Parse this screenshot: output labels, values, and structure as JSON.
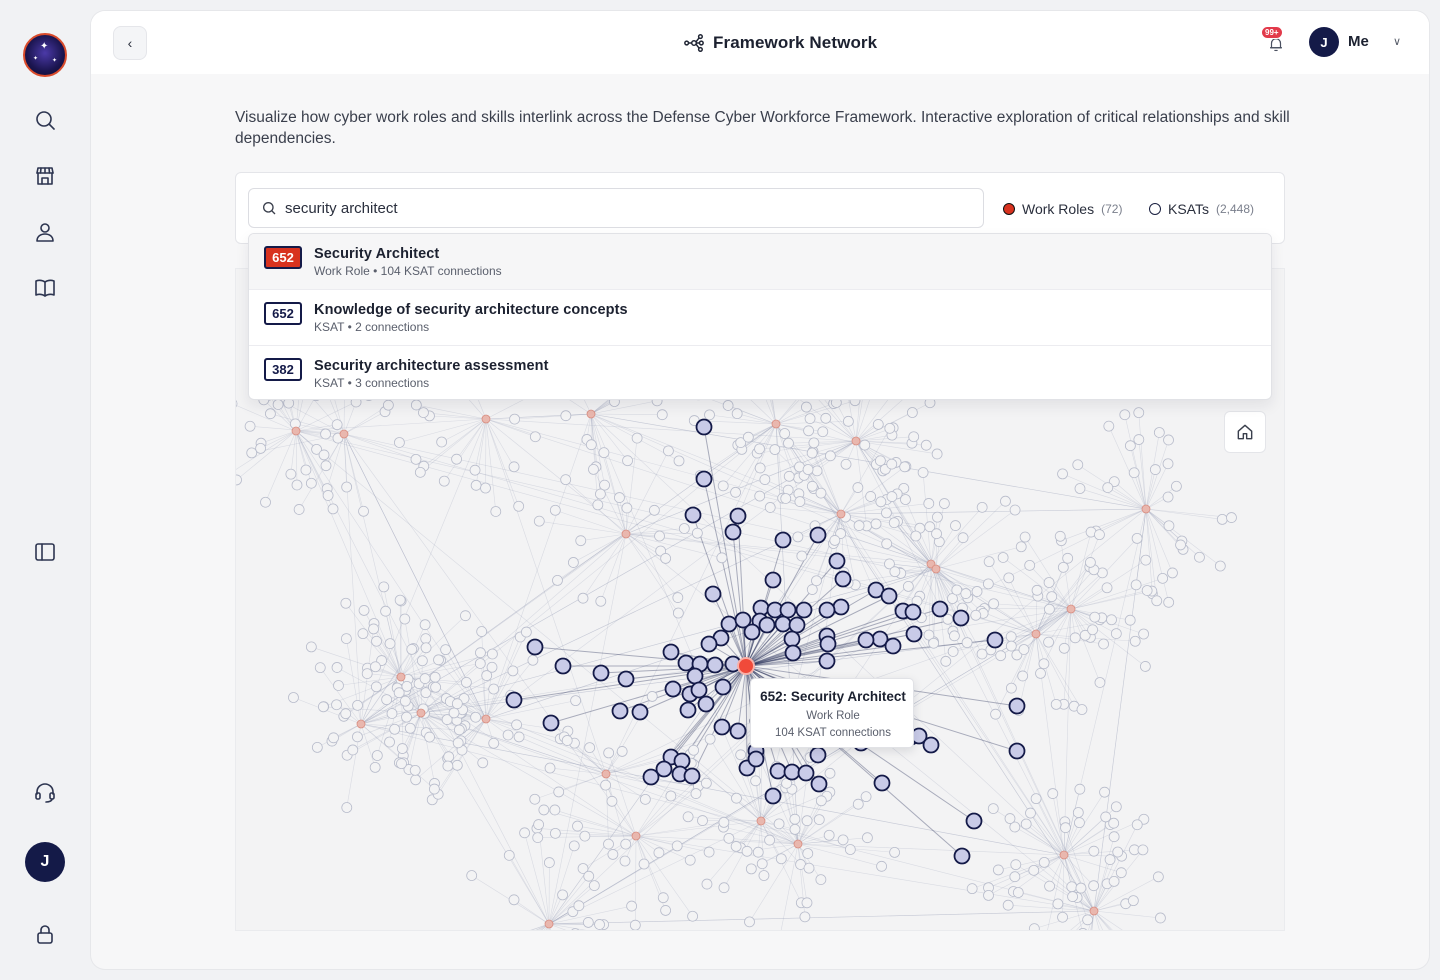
{
  "sidebar": {
    "items": [
      {
        "name": "search-icon"
      },
      {
        "name": "store-icon"
      },
      {
        "name": "user-icon"
      },
      {
        "name": "book-icon"
      },
      {
        "name": "panel-icon"
      },
      {
        "name": "headset-icon"
      },
      {
        "name": "lock-icon"
      }
    ],
    "avatar_initial": "J"
  },
  "header": {
    "title": "Framework Network",
    "notification_badge": "99+",
    "avatar_initial": "J",
    "user_label": "Me"
  },
  "intro_text": "Visualize how cyber work roles and skills interlink across the Defense Cyber Workforce Framework. Interactive exploration of critical relationships and skill dependencies.",
  "search": {
    "value": "security architect",
    "placeholder": "Search"
  },
  "legend": {
    "work_roles_label": "Work Roles",
    "work_roles_count": "(72)",
    "ksats_label": "KSATs",
    "ksats_count": "(2,448)"
  },
  "results": [
    {
      "code": "652",
      "title": "Security Architect",
      "subtitle": "Work Role • 104 KSAT connections",
      "kind": "role"
    },
    {
      "code": "652",
      "title": "Knowledge of security architecture concepts",
      "subtitle": "KSAT • 2 connections",
      "kind": "ksat"
    },
    {
      "code": "382",
      "title": "Security architecture assessment",
      "subtitle": "KSAT • 3 connections",
      "kind": "ksat"
    }
  ],
  "tooltip": {
    "title": "652: Security Architect",
    "type": "Work Role",
    "connections": "104 KSAT connections"
  },
  "colors": {
    "work_role": "#d8321f",
    "ksat_fill": "#c9cbe8",
    "ksat_stroke": "#141a48",
    "brand_navy": "#141a48"
  }
}
